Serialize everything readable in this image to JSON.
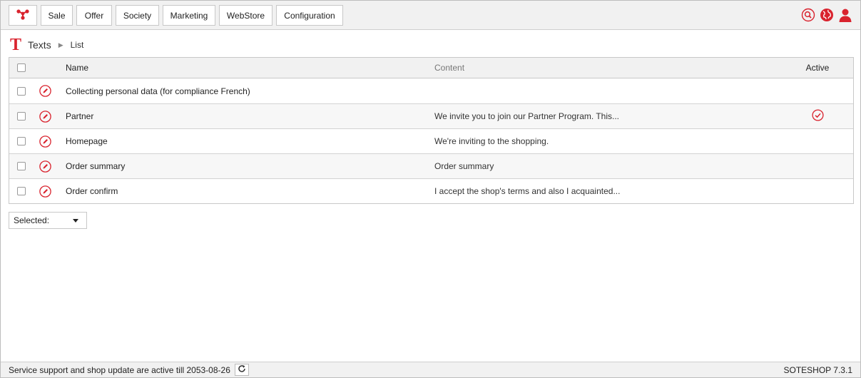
{
  "nav": {
    "logo_icon": "network-logo-icon",
    "items": [
      {
        "label": "Sale"
      },
      {
        "label": "Offer"
      },
      {
        "label": "Society"
      },
      {
        "label": "Marketing"
      },
      {
        "label": "WebStore"
      },
      {
        "label": "Configuration"
      }
    ],
    "right_icons": [
      "search-icon",
      "globe-icon",
      "user-icon"
    ]
  },
  "breadcrumb": {
    "icon_letter": "T",
    "main": "Texts",
    "separator": "▶",
    "sub": "List"
  },
  "table": {
    "headers": {
      "name": "Name",
      "content": "Content",
      "active": "Active"
    },
    "rows": [
      {
        "name": "Collecting personal data (for compliance French)",
        "content": "",
        "active": false
      },
      {
        "name": "Partner",
        "content": "We invite you to join our Partner Program. This...",
        "active": true
      },
      {
        "name": "Homepage",
        "content": "We're inviting to the shopping.",
        "active": false
      },
      {
        "name": "Order summary",
        "content": "Order summary",
        "active": false
      },
      {
        "name": "Order confirm",
        "content": "I accept the shop's terms and also I acquainted...",
        "active": false
      }
    ]
  },
  "bulk": {
    "selected_label": "Selected:"
  },
  "footer": {
    "support_text": "Service support and shop update are active till 2053-08-26",
    "version": "SOTESHOP 7.3.1"
  },
  "colors": {
    "accent": "#d9232e",
    "bar_bg": "#f1f1f1",
    "border": "#c8c8c8"
  }
}
